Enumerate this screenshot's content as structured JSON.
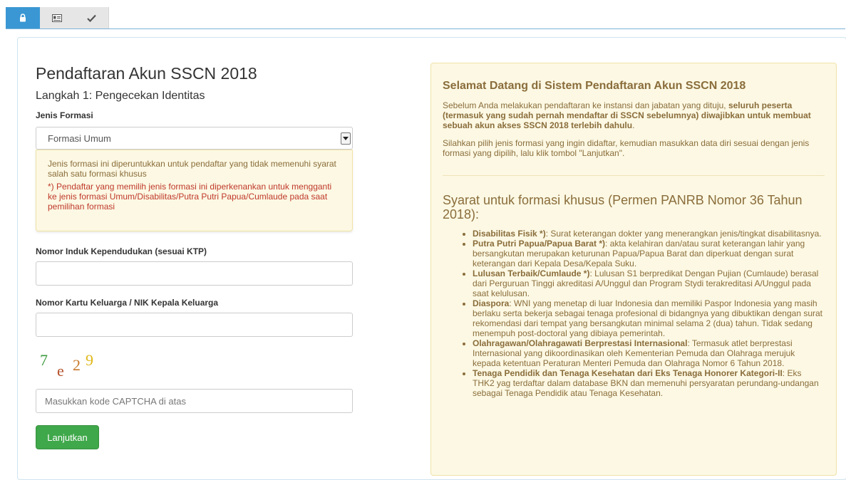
{
  "tabs": [
    {
      "icon": "lock-icon",
      "active": true
    },
    {
      "icon": "id-card-icon",
      "active": false
    },
    {
      "icon": "checkmark-icon",
      "active": false
    }
  ],
  "form": {
    "title": "Pendaftaran Akun SSCN 2018",
    "step": "Langkah 1: Pengecekan Identitas",
    "formation_label": "Jenis Formasi",
    "formation_selected": "Formasi Umum",
    "formation_info": "Jenis formasi ini diperuntukkan untuk pendaftar yang tidak memenuhi syarat salah satu formasi khusus",
    "formation_warning": "*) Pendaftar yang memilih jenis formasi ini diperkenankan untuk mengganti ke jenis formasi Umum/Disabilitas/Putra Putri Papua/Cumlaude pada saat pemilihan formasi",
    "nik_label": "Nomor Induk Kependudukan (sesuai KTP)",
    "nik_value": "",
    "kk_label": "Nomor Kartu Keluarga / NIK Kepala Keluarga",
    "kk_value": "",
    "captcha_chars": [
      {
        "char": "7",
        "color": "#3c9a3c"
      },
      {
        "char": "e",
        "color": "#b5502a"
      },
      {
        "char": "2",
        "color": "#c8782a"
      },
      {
        "char": "9",
        "color": "#e0b81a"
      }
    ],
    "captcha_placeholder": "Masukkan kode CAPTCHA di atas",
    "submit_label": "Lanjutkan"
  },
  "info": {
    "welcome_title": "Selamat Datang di Sistem Pendaftaran Akun SSCN 2018",
    "intro1_normal": "Sebelum Anda melakukan pendaftaran ke instansi dan jabatan yang dituju, ",
    "intro1_bold": "seluruh peserta (termasuk yang sudah pernah mendaftar di SSCN sebelumnya) diwajibkan untuk membuat sebuah akun akses SSCN 2018 terlebih dahulu",
    "intro1_end": ".",
    "intro2": "Silahkan pilih jenis formasi yang ingin didaftar, kemudian masukkan data diri sesuai dengan jenis formasi yang dipilih, lalu klik tombol \"Lanjutkan\".",
    "requirements_title": "Syarat untuk formasi khusus (Permen PANRB Nomor 36 Tahun 2018):",
    "requirements": [
      {
        "title": "Disabilitas Fisik *)",
        "text": ": Surat keterangan dokter yang menerangkan jenis/tingkat disabilitasnya."
      },
      {
        "title": "Putra Putri Papua/Papua Barat *)",
        "text": ": akta kelahiran dan/atau surat keterangan lahir yang bersangkutan merupakan keturunan Papua/Papua Barat dan diperkuat dengan surat keterangan dari Kepala Desa/Kepala Suku."
      },
      {
        "title": "Lulusan Terbaik/Cumlaude *)",
        "text": ": Lulusan S1 berpredikat Dengan Pujian (Cumlaude) berasal dari Perguruan Tinggi akreditasi A/Unggul dan Program Stydi terakreditasi A/Unggul pada saat kelulusan."
      },
      {
        "title": "Diaspora",
        "text": ": WNI yang menetap di luar Indonesia dan memiliki Paspor Indonesia yang masih berlaku serta bekerja sebagai tenaga profesional di bidangnya yang dibuktikan dengan surat rekomendasi dari tempat yang bersangkutan minimal selama 2 (dua) tahun. Tidak sedang menempuh post-doctoral yang dibiaya pemerintah."
      },
      {
        "title": "Olahragawan/Olahragawati Berprestasi Internasional",
        "text": ": Termasuk atlet berprestasi Internasional yang dikoordinasikan oleh Kementerian Pemuda dan Olahraga merujuk kepada ketentuan Peraturan Menteri Pemuda dan Olahraga Nomor 6 Tahun 2018."
      },
      {
        "title": "Tenaga Pendidik dan Tenaga Kesehatan dari Eks Tenaga Honorer Kategori-II",
        "text": ": Eks THK2 yag terdaftar dalam database BKN dan memenuhi persyaratan perundang-undangan sebagai Tenaga Pendidik atau Tenaga Kesehatan."
      }
    ]
  },
  "colors": {
    "tab_active": "#3a97d4",
    "button_green": "#3fa84a",
    "warning_text": "#8a6d3b",
    "warning_bg": "#fcf8e3",
    "error_text": "#c0392b"
  }
}
